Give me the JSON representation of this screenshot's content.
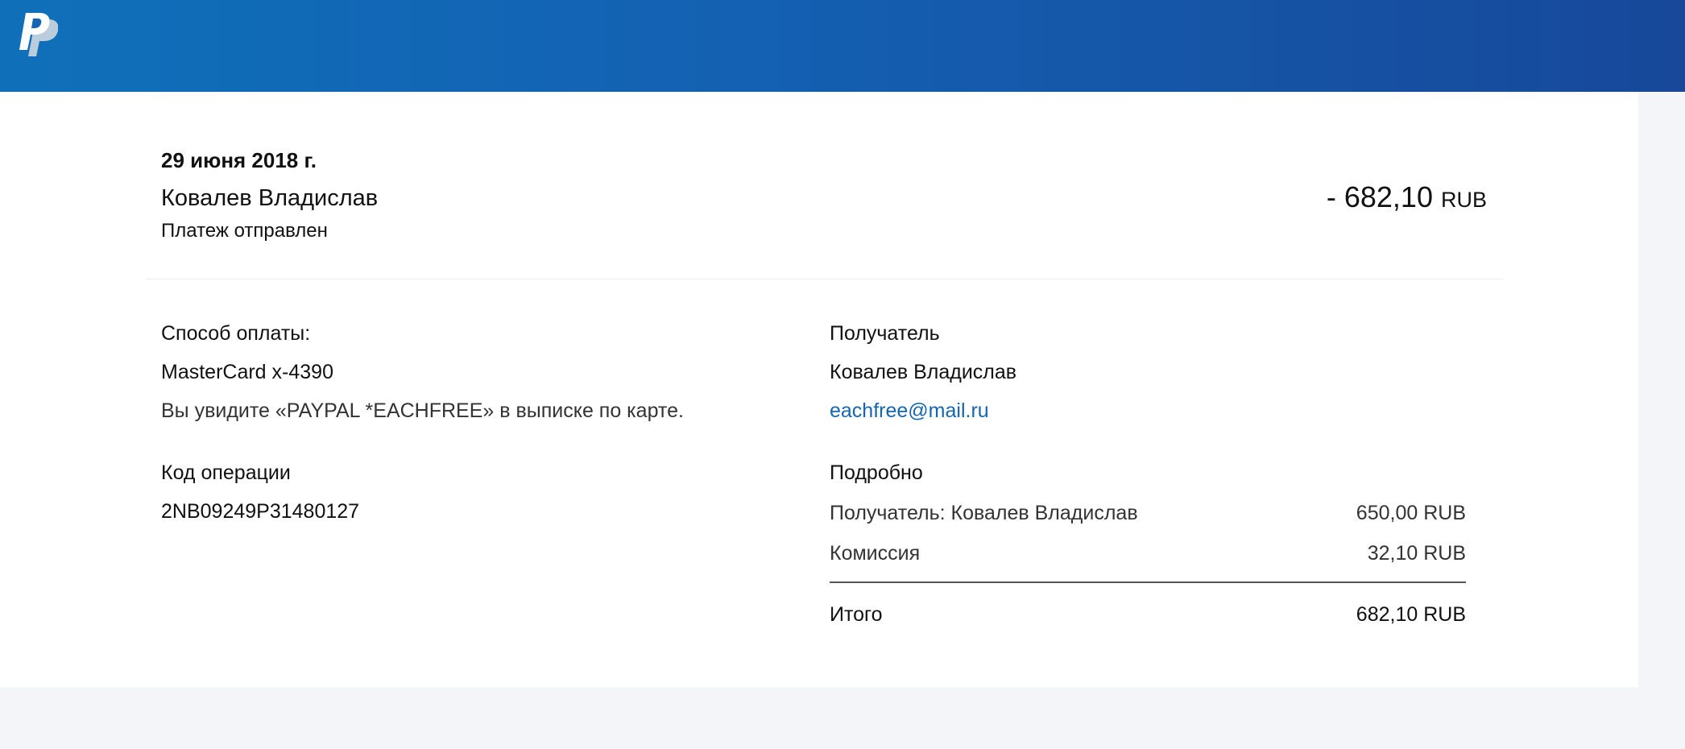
{
  "header": {
    "logo_icon": "paypal-logo-icon",
    "gradient_start": "#0f70b9",
    "gradient_end": "#17489a"
  },
  "transaction": {
    "date": "29 июня 2018 г.",
    "counterparty": "Ковалев Владислав",
    "status": "Платеж отправлен",
    "amount": "- 682,10",
    "currency": "RUB"
  },
  "payment_method": {
    "label": "Способ оплаты:",
    "card": "MasterCard x-4390",
    "statement_note": "Вы увидите «PAYPAL *EACHFREE» в выписке по карте."
  },
  "transaction_id": {
    "label": "Код операции",
    "value": "2NB09249P31480127"
  },
  "recipient": {
    "label": "Получатель",
    "name": "Ковалев Владислав",
    "email": "eachfree@mail.ru"
  },
  "details": {
    "label": "Подробно",
    "rows": [
      {
        "label": "Получатель: Ковалев Владислав",
        "amount": "650,00 RUB"
      },
      {
        "label": "Комиссия",
        "amount": "32,10 RUB"
      }
    ],
    "total_label": "Итого",
    "total_amount": "682,10 RUB"
  },
  "colors": {
    "link": "#1566b0",
    "page_background": "#f4f5f9"
  }
}
